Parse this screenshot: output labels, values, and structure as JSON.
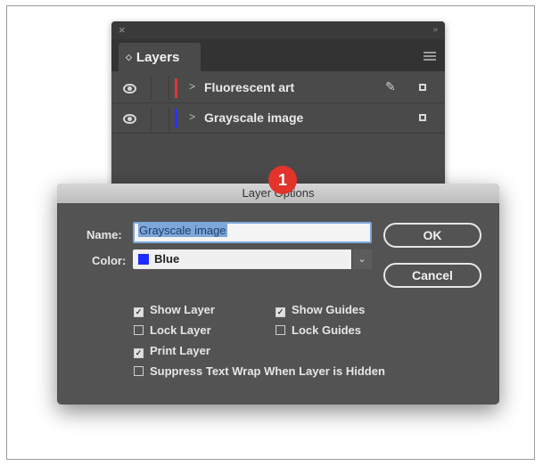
{
  "layers_panel": {
    "close_glyph": "×",
    "collapse_glyph": "»",
    "tab_updown_glyph": "◇",
    "tab_label": "Layers",
    "layers": [
      {
        "name": "Fluorescent art",
        "color": "#e53333",
        "locked_icon": "pencil-icon"
      },
      {
        "name": "Grayscale image",
        "color": "#2a33ff"
      }
    ]
  },
  "callout": "1",
  "dialog": {
    "title": "Layer Options",
    "name_label": "Name:",
    "name_value": "Grayscale image",
    "color_label": "Color:",
    "color_value": "Blue",
    "color_swatch": "#1f2bff",
    "ok_label": "OK",
    "cancel_label": "Cancel",
    "checkboxes": [
      {
        "label": "Show Layer",
        "checked": true
      },
      {
        "label": "Show Guides",
        "checked": true
      },
      {
        "label": "Lock Layer",
        "checked": false
      },
      {
        "label": "Lock Guides",
        "checked": false
      },
      {
        "label": "Print Layer",
        "checked": true
      },
      {
        "label": "Suppress Text Wrap When Layer is Hidden",
        "checked": false
      }
    ]
  }
}
